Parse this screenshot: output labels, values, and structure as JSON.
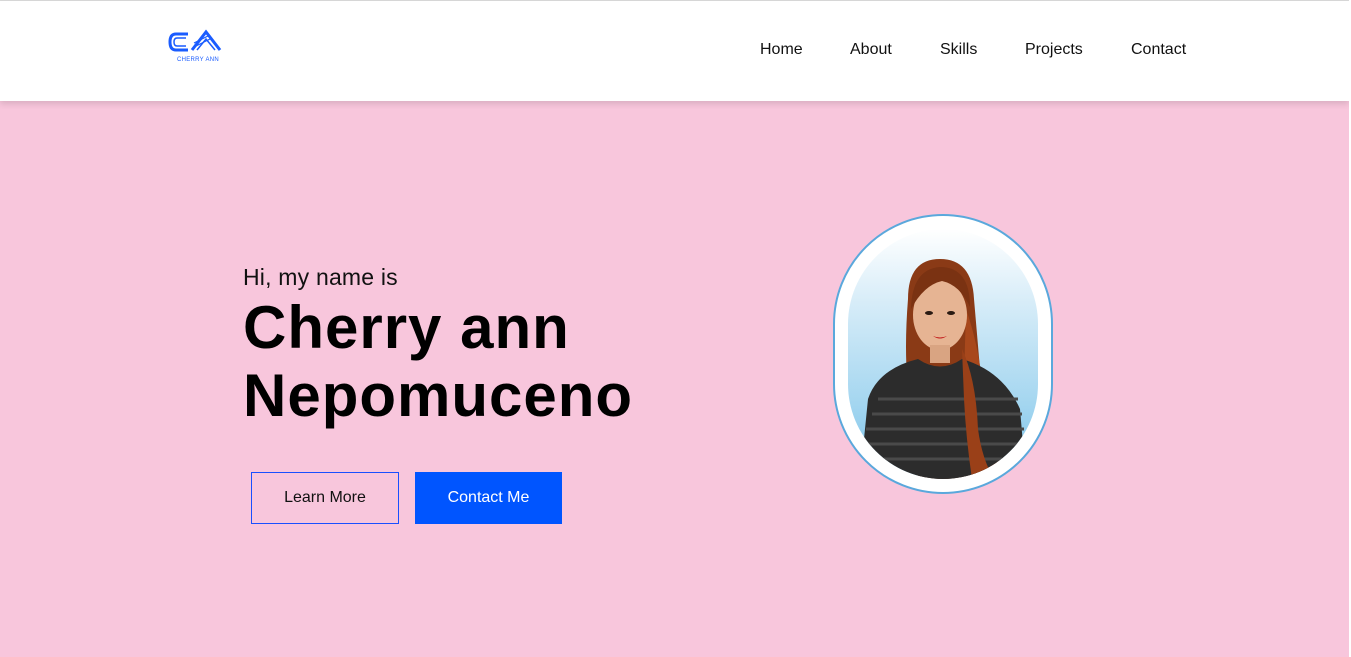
{
  "navbar": {
    "logo_text": "CHERRY ANN",
    "links": [
      "Home",
      "About",
      "Skills",
      "Projects",
      "Contact"
    ]
  },
  "hero": {
    "greeting": "Hi, my name is",
    "name_line1": "Cherry ann",
    "name_line2": "Nepomuceno",
    "learn_more": "Learn More",
    "contact_me": "Contact Me",
    "photo_alt": "profile-photo"
  },
  "colors": {
    "hero_bg": "#f8c6dc",
    "accent_blue": "#0055ff",
    "frame_border": "#5aa8dc"
  }
}
